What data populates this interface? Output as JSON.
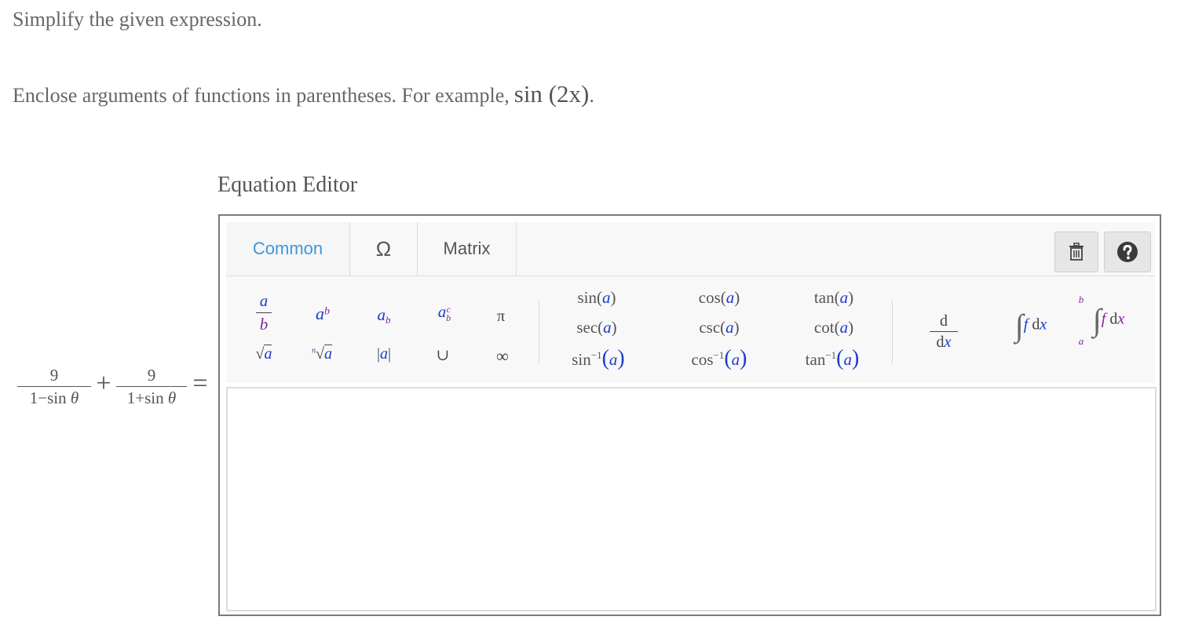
{
  "question": {
    "instruction_1": "Simplify the given expression.",
    "instruction_2": "Enclose arguments of functions in parentheses. For example,",
    "example_fn": "sin",
    "example_arg": "2x",
    "example_end": "."
  },
  "expression": {
    "frac1_num": "9",
    "frac1_den": "1−sin",
    "frac2_num": "9",
    "frac2_den": "1+sin",
    "theta": "θ",
    "plus": "+",
    "equals": "="
  },
  "editor": {
    "title": "Equation Editor",
    "tabs": [
      {
        "label": "Common"
      },
      {
        "label": "Ω"
      },
      {
        "label": "Matrix"
      }
    ],
    "active_tab": "Common",
    "symbols": {
      "pi": "π",
      "union": "∪",
      "infinity": "∞",
      "abs": "|a|"
    },
    "functions": {
      "sin": "sin",
      "cos": "cos",
      "tan": "tan",
      "sec": "sec",
      "csc": "csc",
      "cot": "cot",
      "inv": "−1",
      "arg": "a"
    },
    "calculus": {
      "d": "d",
      "dx": "x",
      "f": "f",
      "lower": "a",
      "upper": "b"
    }
  },
  "colors": {
    "active_tab": "#3a98e0",
    "variable_blue": "#1a3ccf",
    "variable_purple": "#7a2a9a",
    "border": "#7a7a7a"
  },
  "icons": [
    "trash-icon",
    "help-icon"
  ]
}
